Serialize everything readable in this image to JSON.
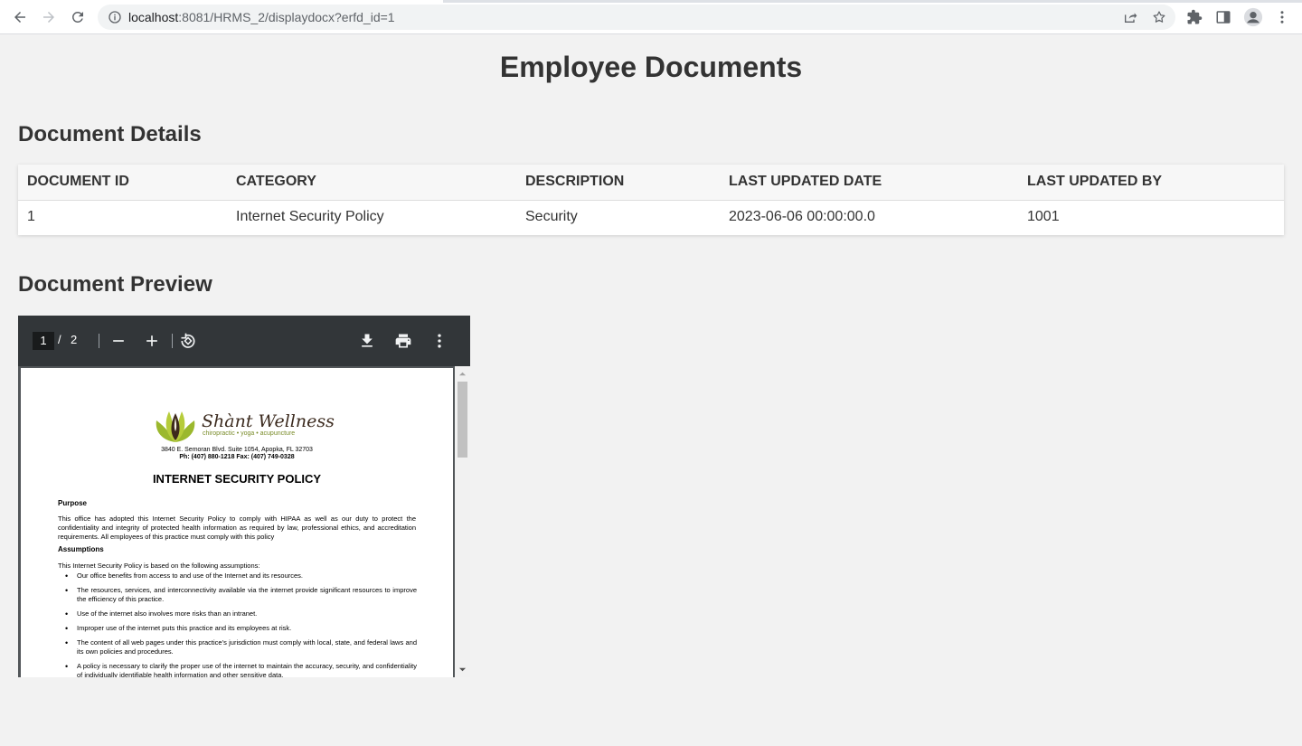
{
  "browser": {
    "url_host": "localhost",
    "url_rest": ":8081/HRMS_2/displaydocx?erfd_id=1"
  },
  "page": {
    "title": "Employee Documents",
    "details_heading": "Document Details",
    "preview_heading": "Document Preview"
  },
  "table": {
    "headers": [
      "DOCUMENT ID",
      "CATEGORY",
      "DESCRIPTION",
      "LAST UPDATED DATE",
      "LAST UPDATED BY"
    ],
    "rows": [
      [
        "1",
        "Internet Security Policy",
        "Security",
        "2023-06-06 00:00:00.0",
        "1001"
      ]
    ]
  },
  "pdf_viewer": {
    "current_page": "1",
    "separator": "/",
    "total_pages": "2",
    "icons": [
      "zoom-out-icon",
      "zoom-in-icon",
      "rotate-icon",
      "download-icon",
      "print-icon",
      "more-options-icon"
    ]
  },
  "document": {
    "brand": "Shànt Wellness",
    "tagline": "chiropractic • yoga • acupuncture",
    "address": "3840 E. Semoran Blvd. Suite 1054, Apopka, FL 32703",
    "phone": "Ph: (407) 880-1218   Fax: (407) 749-0328",
    "title": "INTERNET SECURITY POLICY",
    "purpose_heading": "Purpose",
    "purpose_text": "This office has adopted this Internet Security Policy to comply with HIPAA as well as our duty to protect the confidentiality and integrity of protected health information as required by law, professional ethics, and accreditation requirements. All employees of this practice must comply with this policy",
    "assumptions_heading": "Assumptions",
    "assumptions_intro": "This Internet Security Policy is based on the following assumptions:",
    "assumptions": [
      "Our office benefits from access to and use of the Internet and its resources.",
      "The resources, services, and interconnectivity available via the internet provide significant resources to improve the efficiency of this practice.",
      "Use of the internet also involves more risks than an intranet.",
      "Improper use of the internet puts this practice and its employees at risk.",
      "The content of all web pages under this practice’s jurisdiction must comply with local, state, and federal laws and its own policies and procedures.",
      "A policy is necessary to clarify the proper use of the internet to maintain the accuracy, security, and confidentiality of individually identifiable health information and other sensitive data."
    ]
  }
}
